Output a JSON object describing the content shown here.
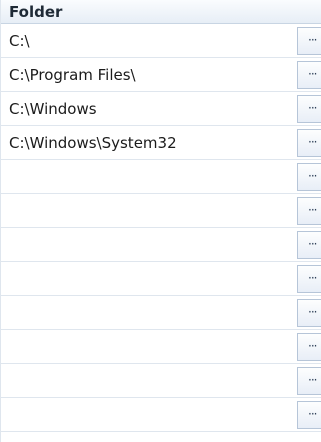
{
  "grid": {
    "header": "Folder",
    "button_label": "···",
    "rows": [
      {
        "path": "C:\\"
      },
      {
        "path": "C:\\Program Files\\"
      },
      {
        "path": "C:\\Windows"
      },
      {
        "path": "C:\\Windows\\System32"
      },
      {
        "path": ""
      },
      {
        "path": ""
      },
      {
        "path": ""
      },
      {
        "path": ""
      },
      {
        "path": ""
      },
      {
        "path": ""
      },
      {
        "path": ""
      },
      {
        "path": ""
      }
    ]
  }
}
